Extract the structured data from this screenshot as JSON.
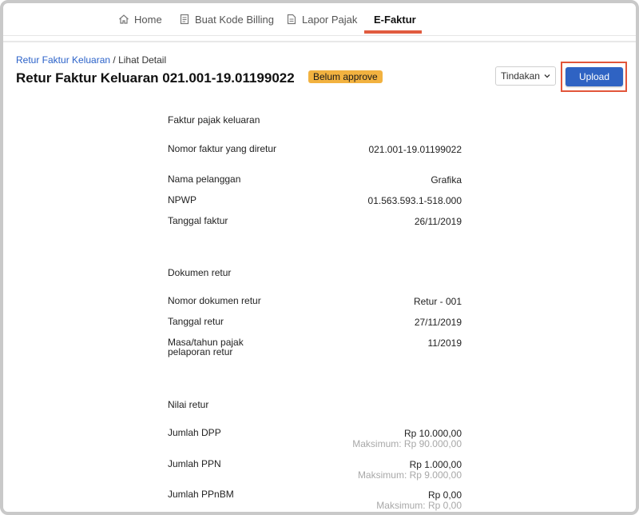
{
  "nav": {
    "items": [
      {
        "label": "Home",
        "icon": "home-icon"
      },
      {
        "label": "Buat Kode Billing",
        "icon": "document-icon"
      },
      {
        "label": "Lapor Pajak",
        "icon": "report-icon"
      },
      {
        "label": "E-Faktur",
        "icon": ""
      }
    ],
    "active": "E-Faktur",
    "accent_color": "#e15b3f"
  },
  "header": {
    "breadcrumb_link": "Retur Faktur Keluaran",
    "breadcrumb_sep": "/",
    "breadcrumb_current": "Lihat Detail",
    "title": "Retur Faktur Keluaran 021.001-19.01199022",
    "status_badge": "Belum approve",
    "status_color": "#f2b240",
    "actions_label": "Tindakan",
    "upload_label": "Upload",
    "upload_color": "#2f63c3"
  },
  "faktur": {
    "section_title": "Faktur pajak keluaran",
    "nomor_label": "Nomor faktur yang diretur",
    "nomor_value": "021.001-19.01199022",
    "nama_label": "Nama pelanggan",
    "nama_value": "Grafika",
    "npwp_label": "NPWP",
    "npwp_value": "01.563.593.1-518.000",
    "tanggal_label": "Tanggal faktur",
    "tanggal_value": "26/11/2019"
  },
  "dokumen": {
    "section_title": "Dokumen retur",
    "nomor_label": "Nomor dokumen retur",
    "nomor_value": "Retur - 001",
    "tanggal_label": "Tanggal retur",
    "tanggal_value": "27/11/2019",
    "masa_label": "Masa/tahun pajak pelaporan retur",
    "masa_value": "11/2019"
  },
  "nilai": {
    "section_title": "Nilai retur",
    "dpp_label": "Jumlah DPP",
    "dpp_value": "Rp 10.000,00",
    "dpp_max": "Maksimum: Rp 90.000,00",
    "ppn_label": "Jumlah PPN",
    "ppn_value": "Rp 1.000,00",
    "ppn_max": "Maksimum: Rp 9.000,00",
    "ppnbm_label": "Jumlah PPnBM",
    "ppnbm_value": "Rp 0,00",
    "ppnbm_max": "Maksimum: Rp 0,00"
  }
}
